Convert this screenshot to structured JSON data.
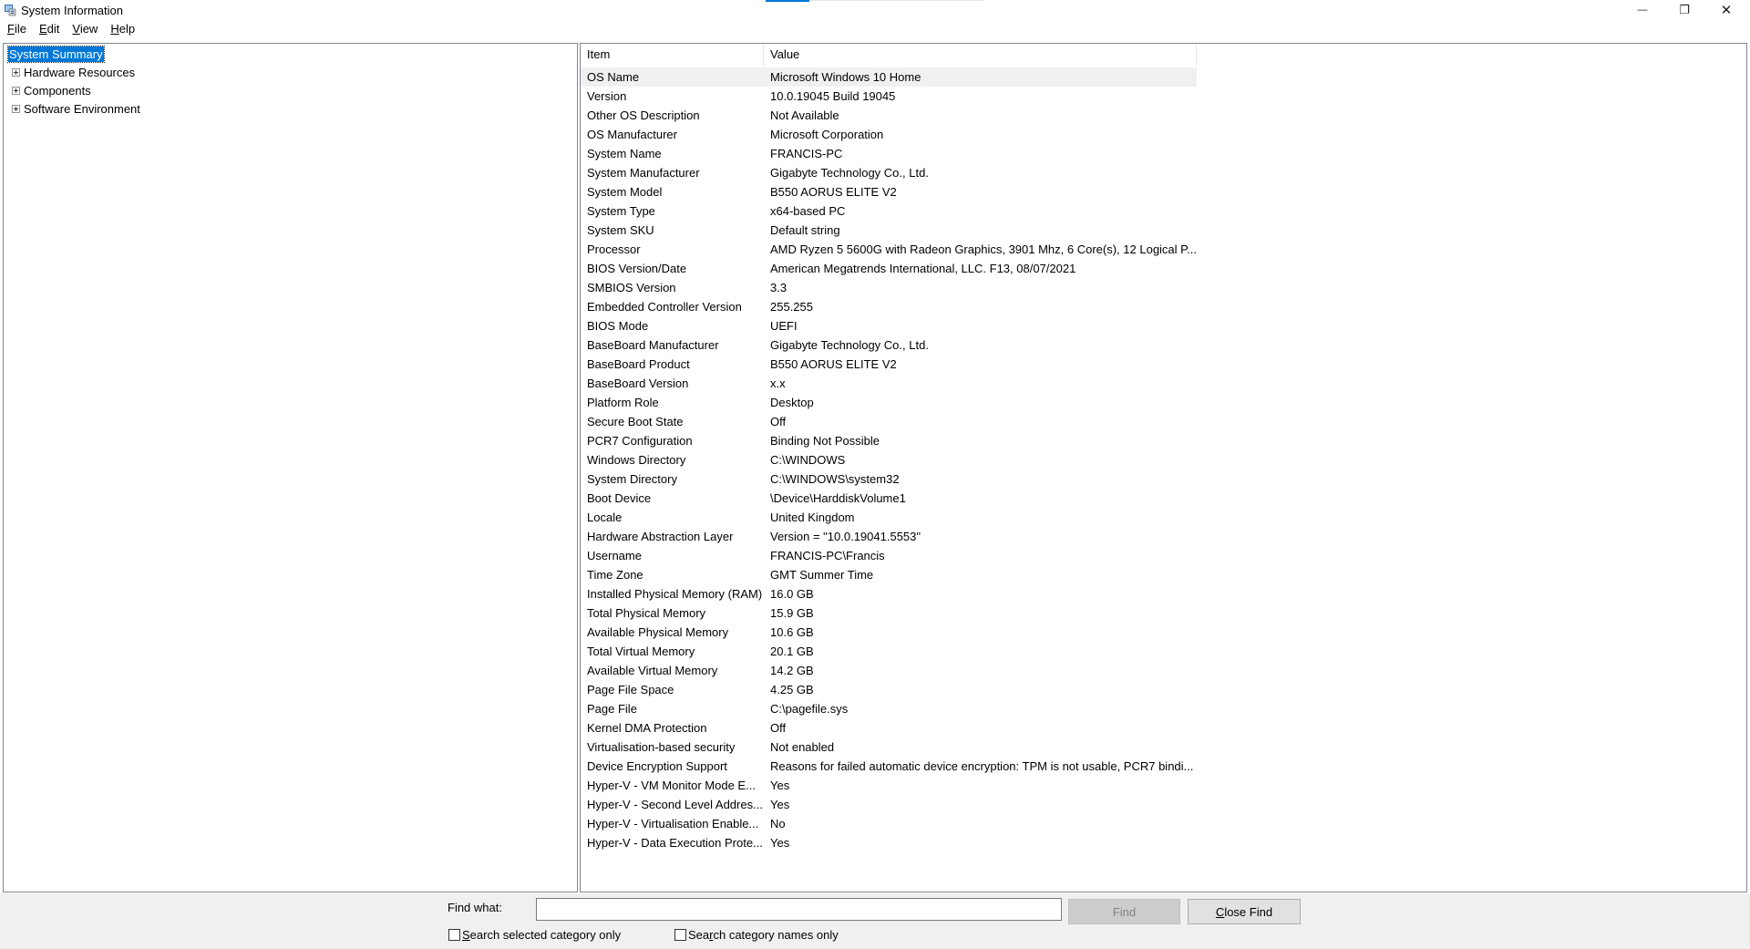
{
  "window": {
    "title": "System Information",
    "controls": {
      "minimize": "—",
      "maximize": "❐",
      "close": "✕"
    }
  },
  "menu": [
    {
      "accel": "F",
      "rest": "ile"
    },
    {
      "accel": "E",
      "rest": "dit"
    },
    {
      "accel": "V",
      "rest": "iew"
    },
    {
      "accel": "H",
      "rest": "elp"
    }
  ],
  "tree": {
    "selected": "System Summary",
    "children": [
      "Hardware Resources",
      "Components",
      "Software Environment"
    ]
  },
  "list": {
    "headers": {
      "item": "Item",
      "value": "Value"
    },
    "rows": [
      [
        "OS Name",
        "Microsoft Windows 10 Home"
      ],
      [
        "Version",
        "10.0.19045 Build 19045"
      ],
      [
        "Other OS Description",
        "Not Available"
      ],
      [
        "OS Manufacturer",
        "Microsoft Corporation"
      ],
      [
        "System Name",
        "FRANCIS-PC"
      ],
      [
        "System Manufacturer",
        "Gigabyte Technology Co., Ltd."
      ],
      [
        "System Model",
        "B550 AORUS ELITE V2"
      ],
      [
        "System Type",
        "x64-based PC"
      ],
      [
        "System SKU",
        "Default string"
      ],
      [
        "Processor",
        "AMD Ryzen 5 5600G with Radeon Graphics, 3901 Mhz, 6 Core(s), 12 Logical P..."
      ],
      [
        "BIOS Version/Date",
        "American Megatrends International, LLC. F13, 08/07/2021"
      ],
      [
        "SMBIOS Version",
        "3.3"
      ],
      [
        "Embedded Controller Version",
        "255.255"
      ],
      [
        "BIOS Mode",
        "UEFI"
      ],
      [
        "BaseBoard Manufacturer",
        "Gigabyte Technology Co., Ltd."
      ],
      [
        "BaseBoard Product",
        "B550 AORUS ELITE V2"
      ],
      [
        "BaseBoard Version",
        "x.x"
      ],
      [
        "Platform Role",
        "Desktop"
      ],
      [
        "Secure Boot State",
        "Off"
      ],
      [
        "PCR7 Configuration",
        "Binding Not Possible"
      ],
      [
        "Windows Directory",
        "C:\\WINDOWS"
      ],
      [
        "System Directory",
        "C:\\WINDOWS\\system32"
      ],
      [
        "Boot Device",
        "\\Device\\HarddiskVolume1"
      ],
      [
        "Locale",
        "United Kingdom"
      ],
      [
        "Hardware Abstraction Layer",
        "Version = \"10.0.19041.5553\""
      ],
      [
        "Username",
        "FRANCIS-PC\\Francis"
      ],
      [
        "Time Zone",
        "GMT Summer Time"
      ],
      [
        "Installed Physical Memory (RAM)",
        "16.0 GB"
      ],
      [
        "Total Physical Memory",
        "15.9 GB"
      ],
      [
        "Available Physical Memory",
        "10.6 GB"
      ],
      [
        "Total Virtual Memory",
        "20.1 GB"
      ],
      [
        "Available Virtual Memory",
        "14.2 GB"
      ],
      [
        "Page File Space",
        "4.25 GB"
      ],
      [
        "Page File",
        "C:\\pagefile.sys"
      ],
      [
        "Kernel DMA Protection",
        "Off"
      ],
      [
        "Virtualisation-based security",
        "Not enabled"
      ],
      [
        "Device Encryption Support",
        "Reasons for failed automatic device encryption: TPM is not usable, PCR7 bindi..."
      ],
      [
        "Hyper-V - VM Monitor Mode E...",
        "Yes"
      ],
      [
        "Hyper-V - Second Level Addres...",
        "Yes"
      ],
      [
        "Hyper-V - Virtualisation Enable...",
        "No"
      ],
      [
        "Hyper-V - Data Execution Prote...",
        "Yes"
      ]
    ]
  },
  "find": {
    "label": "Find what:",
    "value": "",
    "find_button": "Find",
    "close_button": "Close Find",
    "checkbox_selected": {
      "accel": "S",
      "rest": "earch selected category only"
    },
    "checkbox_names": {
      "pre": "Sea",
      "accel": "r",
      "rest": "ch category names only"
    }
  }
}
